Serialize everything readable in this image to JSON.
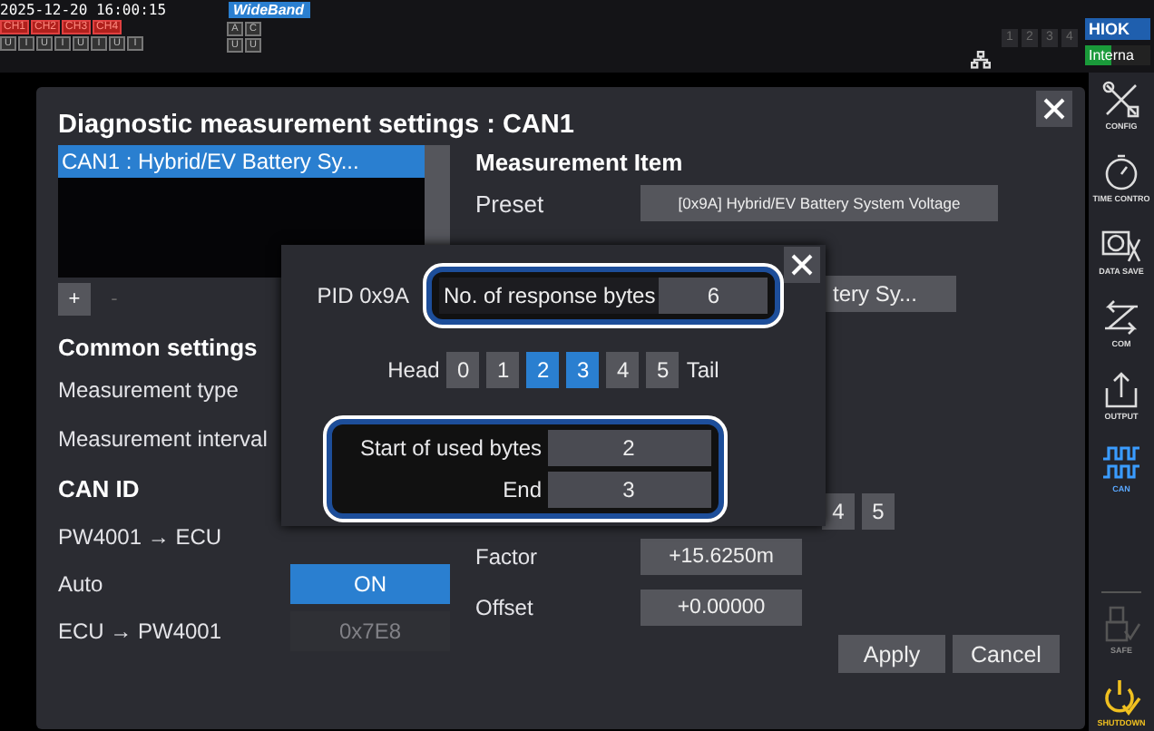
{
  "status_bar": {
    "datetime": "2025-12-20 16:00:15",
    "mode_badge": "WideBand",
    "channels": [
      {
        "label": "CH1"
      },
      {
        "label": "CH2"
      },
      {
        "label": "CH3"
      },
      {
        "label": "CH4"
      }
    ],
    "channel_units": [
      "U",
      "I",
      "U",
      "I",
      "U",
      "I",
      "U",
      "I"
    ],
    "extra_channels": [
      "A",
      "C"
    ],
    "extra_units": [
      "U",
      "U"
    ],
    "pages": [
      "1",
      "2",
      "3",
      "4"
    ],
    "logo": "HIOK",
    "source": "Interna"
  },
  "sidebar": {
    "items": [
      {
        "label": "CONFIG",
        "kind": "nav",
        "selected": false,
        "disabled": false
      },
      {
        "label": "TIME CONTRO",
        "kind": "nav",
        "selected": false,
        "disabled": false
      },
      {
        "label": "DATA SAVE",
        "kind": "nav",
        "selected": false,
        "disabled": false
      },
      {
        "label": "COM",
        "kind": "nav",
        "selected": false,
        "disabled": false
      },
      {
        "label": "OUTPUT",
        "kind": "nav",
        "selected": false,
        "disabled": false
      },
      {
        "label": "CAN",
        "kind": "nav",
        "selected": true,
        "disabled": false
      },
      {
        "label": "SAFE",
        "kind": "nav",
        "selected": false,
        "disabled": true
      },
      {
        "label": "SHUTDOWN",
        "kind": "power"
      }
    ]
  },
  "dialog": {
    "title": "Diagnostic measurement settings : CAN1",
    "items_list": [
      {
        "label": "CAN1 : Hybrid/EV Battery Sy...",
        "selected": true
      }
    ],
    "list_buttons": [
      {
        "label": "+",
        "disabled": false
      },
      {
        "label": "-",
        "disabled": true
      }
    ],
    "common_heading": "Common settings",
    "common_rows": [
      "Measurement type",
      "Measurement interval"
    ],
    "can_id_heading": "CAN ID",
    "can_id_rows": [
      {
        "label": "PW4001 → ECU"
      },
      {
        "label": "Auto",
        "value": "ON",
        "on": true,
        "disabled": false
      },
      {
        "label": "ECU → PW4001",
        "value": "0x7E8",
        "on": false,
        "disabled": true
      }
    ],
    "item_heading": "Measurement Item",
    "preset": {
      "label": "Preset",
      "value": "[0x9A] Hybrid/EV Battery System Voltage"
    },
    "partial_button": "tery Sy...",
    "partial_bytes": [
      "4",
      "5"
    ],
    "factor": {
      "label": "Factor",
      "value": "+15.6250m"
    },
    "offset": {
      "label": "Offset",
      "value": "+0.00000"
    },
    "buttons": [
      "Apply",
      "Cancel"
    ]
  },
  "popup": {
    "pid": "PID 0x9A",
    "response_bytes": {
      "label": "No. of response bytes",
      "value": "6",
      "highlighted": true
    },
    "head": "Head",
    "tail": "Tail",
    "bytes": [
      {
        "label": "0",
        "selected": false
      },
      {
        "label": "1",
        "selected": false
      },
      {
        "label": "2",
        "selected": true
      },
      {
        "label": "3",
        "selected": true
      },
      {
        "label": "4",
        "selected": false
      },
      {
        "label": "5",
        "selected": false
      }
    ],
    "used_bytes": {
      "highlighted": true,
      "start_label": "Start of used bytes",
      "start_value": "2",
      "end_label": "End",
      "end_value": "3"
    }
  }
}
